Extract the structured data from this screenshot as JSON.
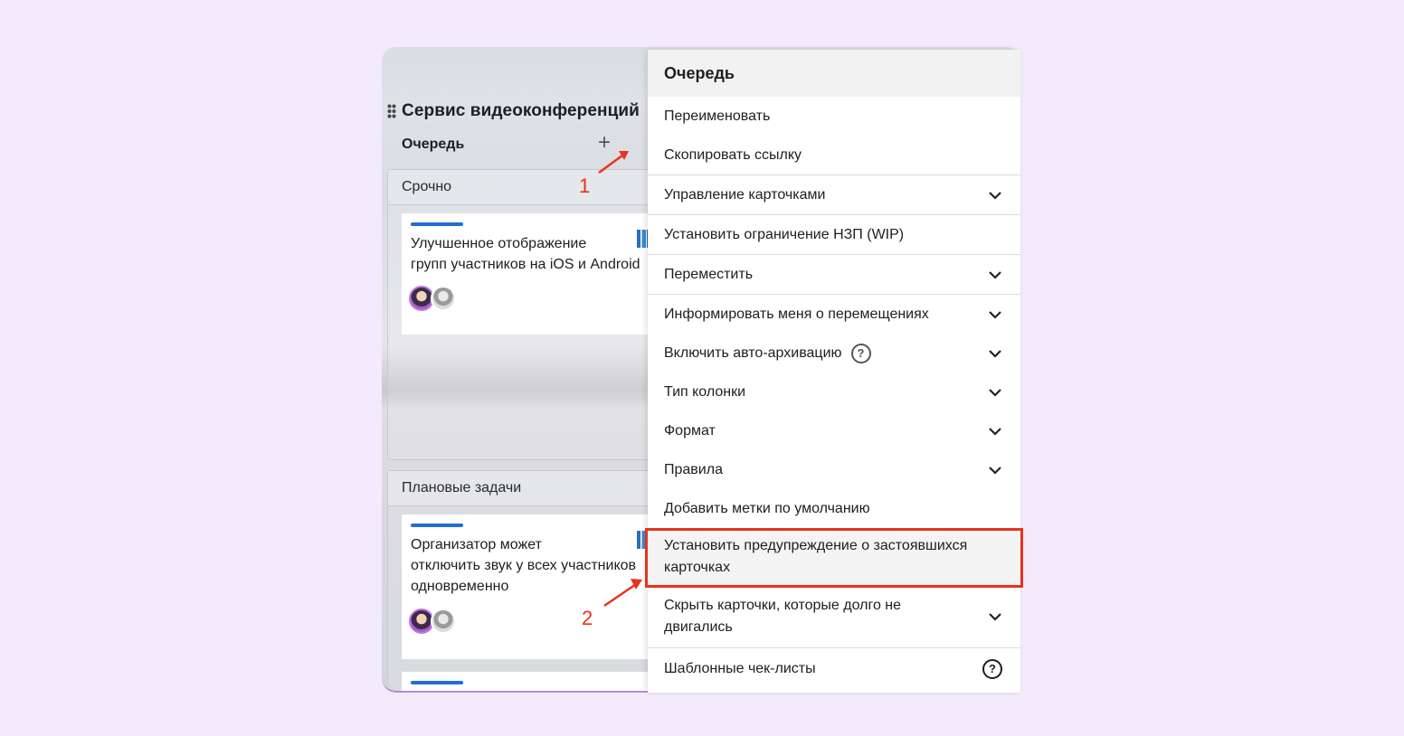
{
  "board": {
    "title": "Сервис видеоконференций",
    "column": {
      "title": "Очередь",
      "add_label": "+"
    },
    "swimlanes": [
      {
        "title": "Срочно",
        "cards": [
          {
            "title_line1": "Улучшенное отображение",
            "title_line2": "групп участников на iOS и Android",
            "title_line3": ""
          }
        ]
      },
      {
        "title": "Плановые задачи",
        "cards": [
          {
            "title_line1": "Организатор может",
            "title_line2": "отключить звук у всех участников",
            "title_line3": "одновременно"
          }
        ]
      }
    ]
  },
  "menu": {
    "header": "Очередь",
    "items": [
      {
        "label": "Переименовать"
      },
      {
        "label": "Скопировать ссылку"
      },
      {
        "label": "Управление карточками"
      },
      {
        "label": "Установить ограничение НЗП (WIP)"
      },
      {
        "label": "Переместить"
      },
      {
        "label": "Информировать меня о перемещениях"
      },
      {
        "label": "Включить авто-архивацию"
      },
      {
        "label": "Тип колонки"
      },
      {
        "label": "Формат"
      },
      {
        "label": "Правила"
      },
      {
        "label": "Добавить метки по умолчанию"
      },
      {
        "label_line1": "Установить предупреждение о застоявшихся",
        "label_line2": "карточках"
      },
      {
        "label_line1": "Скрыть карточки, которые долго не",
        "label_line2": "двигались"
      },
      {
        "label": "Шаблонные чек-листы"
      }
    ],
    "help_glyph": "?"
  },
  "annotations": {
    "step1": "1",
    "step2": "2"
  },
  "colors": {
    "accent_red": "#e8321c",
    "card_bar": "#1f6fd1",
    "background": "#f3eafb"
  }
}
